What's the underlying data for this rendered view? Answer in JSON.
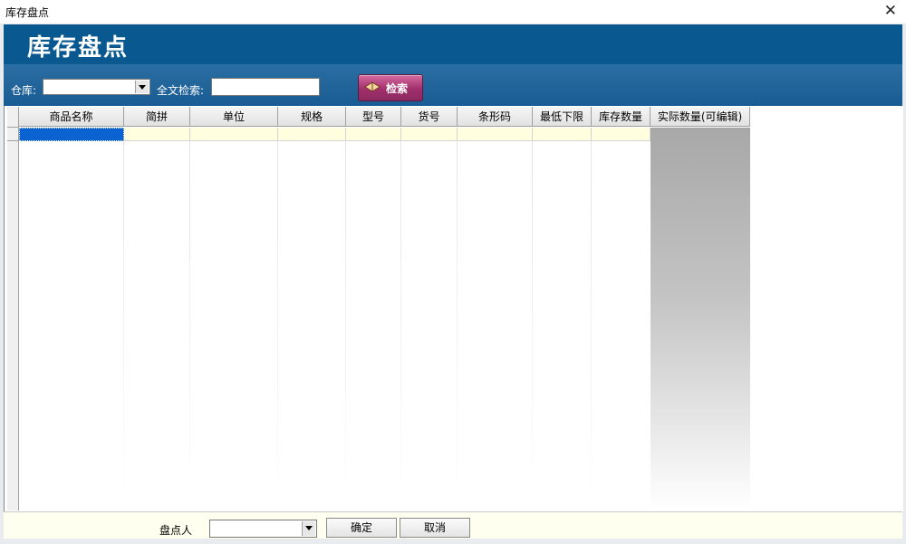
{
  "window": {
    "title": "库存盘点",
    "close_icon": "close-icon"
  },
  "banner": {
    "title": "库存盘点"
  },
  "toolbar": {
    "warehouse_label": "仓库:",
    "warehouse_value": "",
    "search_label": "全文检索:",
    "search_value": "",
    "search_button": "检索",
    "search_button_icon": "book-icon"
  },
  "grid": {
    "columns": [
      "商品名称",
      "简拼",
      "单位",
      "规格",
      "型号",
      "货号",
      "条形码",
      "最低下限",
      "库存数量",
      "实际数量(可编辑)"
    ],
    "rows": [
      [
        "",
        "",
        "",
        "",
        "",
        "",
        "",
        "",
        "",
        ""
      ]
    ]
  },
  "footer": {
    "operator_label": "盘点人",
    "operator_value": "",
    "ok_button": "确定",
    "cancel_button": "取消"
  },
  "colors": {
    "banner": "#095890",
    "toolbar": "#1a5f95",
    "search_button": "#a0306c",
    "row_background": "#ffffe0",
    "selection": "#0a63d0"
  }
}
